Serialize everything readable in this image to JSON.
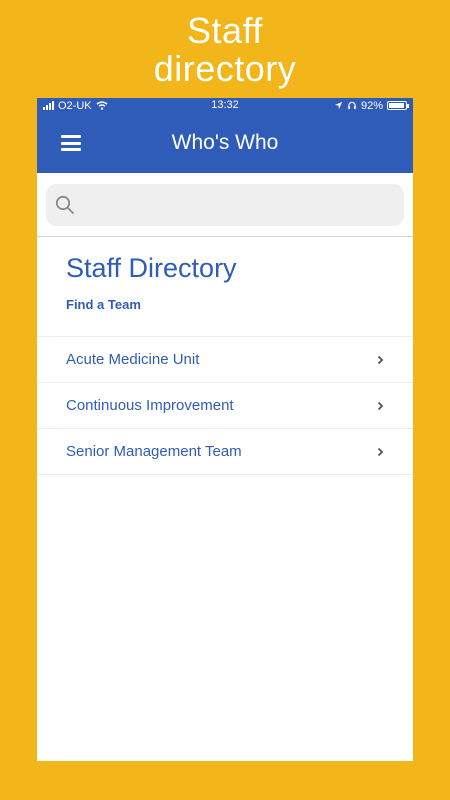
{
  "promo": {
    "line1": "Staff",
    "line2": "directory"
  },
  "status_bar": {
    "carrier": "O2-UK",
    "time": "13:32",
    "battery_percent": "92%",
    "battery_level": 0.92
  },
  "header": {
    "title": "Who's Who"
  },
  "search": {
    "value": "",
    "placeholder": ""
  },
  "main": {
    "title": "Staff Directory",
    "subtitle": "Find a Team",
    "items": [
      {
        "label": "Acute Medicine Unit"
      },
      {
        "label": "Continuous Improvement"
      },
      {
        "label": "Senior Management Team"
      }
    ]
  },
  "colors": {
    "page_background": "#F2B61A",
    "brand_blue": "#2F5CB8",
    "search_background": "#EFEFEF"
  },
  "icons": {
    "menu": "hamburger-menu-icon",
    "search": "search-icon",
    "chevron": "chevron-right-icon",
    "location": "location-arrow-icon",
    "headphones": "headphones-icon",
    "wifi": "wifi-icon",
    "signal": "signal-icon",
    "battery": "battery-icon"
  }
}
